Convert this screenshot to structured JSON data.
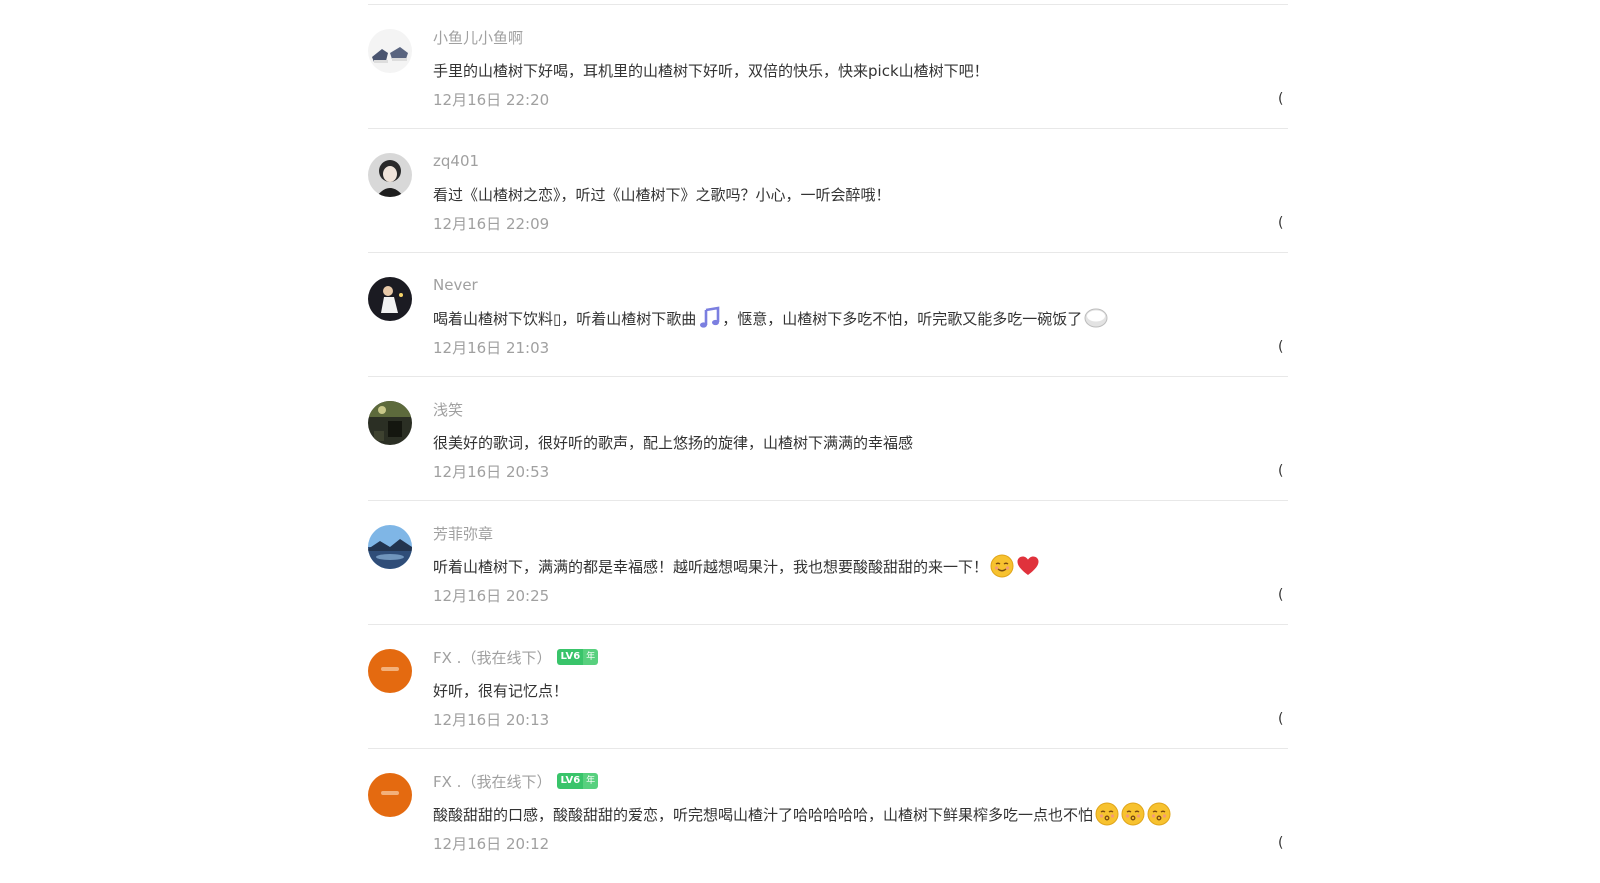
{
  "comments": [
    {
      "username": "小鱼儿小鱼啊",
      "text": "手里的山楂树下好喝，耳机里的山楂树下好听，双倍的快乐，快来pick山楂树下吧！",
      "time": "12月16日 22:20",
      "avatar": "sneaker-photo"
    },
    {
      "username": "zq401",
      "text": "看过《山楂树之恋》，听过《山楂树下》之歌吗？小心，一听会醉哦！",
      "time": "12月16日 22:09",
      "avatar": "portrait-photo"
    },
    {
      "username": "Never",
      "text": "喝着山楂树下饮料▯，听着山楂树下歌曲",
      "text_2": "，惬意，山楂树下多吃不怕，听完歌又能多吃一碗饭了",
      "time": "12月16日 21:03",
      "avatar": "stage-photo",
      "emojis": [
        "music-note-icon",
        "rice-bowl-icon"
      ]
    },
    {
      "username": "浅笑",
      "text": "很美好的歌词，很好听的歌声，配上悠扬的旋律，山楂树下满满的幸福感",
      "time": "12月16日 20:53",
      "avatar": "dark-scene-photo"
    },
    {
      "username": "芳菲弥章",
      "text": "听着山楂树下，满满的都是幸福感！越听越想喝果汁，我也想要酸酸甜甜的来一下！",
      "time": "12月16日 20:25",
      "avatar": "landscape-photo",
      "emojis": [
        "smiling-face-icon",
        "red-heart-icon"
      ]
    },
    {
      "username": "FX .（我在线下）",
      "text": "好听，很有记忆点！",
      "time": "12月16日 20:13",
      "avatar": "orange-logo",
      "badge": {
        "level": "LV6",
        "year": "年"
      }
    },
    {
      "username": "FX .（我在线下）",
      "text": "酸酸甜甜的口感，酸酸甜甜的爱恋，听完想喝山楂汁了哈哈哈哈哈，山楂树下鲜果榨多吃一点也不怕",
      "time": "12月16日 20:12",
      "avatar": "orange-logo",
      "badge": {
        "level": "LV6",
        "year": "年"
      },
      "emojis": [
        "kissing-face-icon",
        "kissing-face-icon",
        "kissing-face-icon"
      ]
    }
  ],
  "action_glyph": "(",
  "colors": {
    "username": "#a0a0a0",
    "text": "#333333",
    "time": "#a0a0a0",
    "divider": "#e8e8e8",
    "badge": "#39c46a",
    "orange_avatar": "#e46a10"
  }
}
